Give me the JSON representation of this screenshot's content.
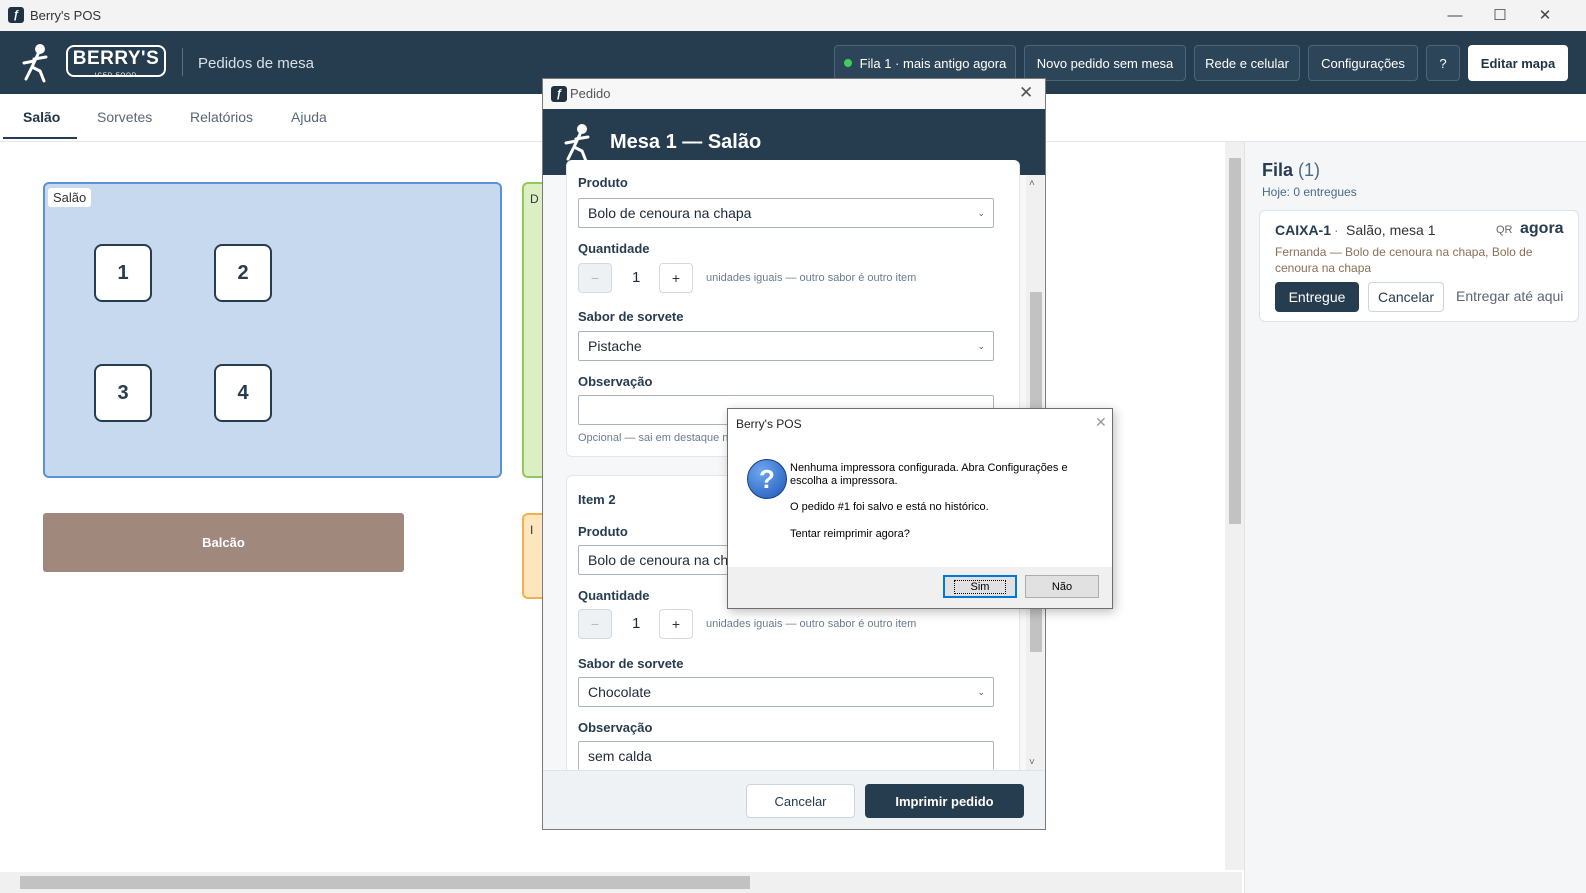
{
  "window": {
    "title": "Berry's POS",
    "minimize": "—",
    "maximize": "☐",
    "close": "✕"
  },
  "header": {
    "logo_text": "BERRY'S",
    "logo_sub": "ICED FOOD",
    "section_title": "Pedidos de mesa",
    "buttons": {
      "fila": "Fila 1 · mais antigo agora",
      "novo_pedido": "Novo pedido sem mesa",
      "rede": "Rede e celular",
      "config": "Configurações",
      "help": "?",
      "editar_mapa": "Editar mapa"
    }
  },
  "tabs": [
    "Salão",
    "Sorvetes",
    "Relatórios",
    "Ajuda"
  ],
  "floor": {
    "zone_label": "Salão",
    "tables": [
      "1",
      "2",
      "3",
      "4"
    ],
    "balcao": "Balcão",
    "green_zone_initial": "D",
    "orange_zone_initial": "I"
  },
  "queue": {
    "title": "Fila",
    "count": "(1)",
    "subtitle": "Hoje: 0 entregues",
    "card": {
      "id": "CAIXA-1",
      "sep": "·",
      "location": "Salão, mesa 1",
      "qr": "QR",
      "time": "agora",
      "desc": "Fernanda  —  Bolo de cenoura na chapa, Bolo de cenoura na chapa",
      "btn_entregue": "Entregue",
      "btn_cancelar": "Cancelar",
      "link_entregar": "Entregar até aqui"
    }
  },
  "pedido": {
    "window_title": "Pedido",
    "header_title": "Mesa 1 — Salão",
    "item1": {
      "produto_label": "Produto",
      "produto": "Bolo de cenoura na chapa",
      "quantidade_label": "Quantidade",
      "quantidade": "1",
      "minus": "−",
      "plus": "+",
      "qty_hint": "unidades iguais — outro sabor é outro item",
      "sabor_label": "Sabor de sorvete",
      "sabor": "Pistache",
      "obs_label": "Observação",
      "obs_value": "",
      "obs_hint": "Opcional — sai em destaque na"
    },
    "item2": {
      "title": "Item 2",
      "produto_label": "Produto",
      "produto": "Bolo de cenoura na chapa",
      "quantidade_label": "Quantidade",
      "quantidade": "1",
      "minus": "−",
      "plus": "+",
      "qty_hint": "unidades iguais — outro sabor é outro item",
      "sabor_label": "Sabor de sorvete",
      "sabor": "Chocolate",
      "obs_label": "Observação",
      "obs_value": "sem calda"
    },
    "btn_cancelar": "Cancelar",
    "btn_imprimir": "Imprimir pedido"
  },
  "msgbox": {
    "title": "Berry's POS",
    "line1": "Nenhuma impressora configurada. Abra Configurações e escolha a impressora.",
    "line2": "O pedido #1 foi salvo e está no histórico.",
    "line3": "Tentar reimprimir agora?",
    "btn_sim": "Sim",
    "btn_nao": "Não"
  },
  "icons": [
    "app-icon",
    "mascot-icon",
    "question-icon",
    "chevron-down-icon",
    "close-icon"
  ]
}
